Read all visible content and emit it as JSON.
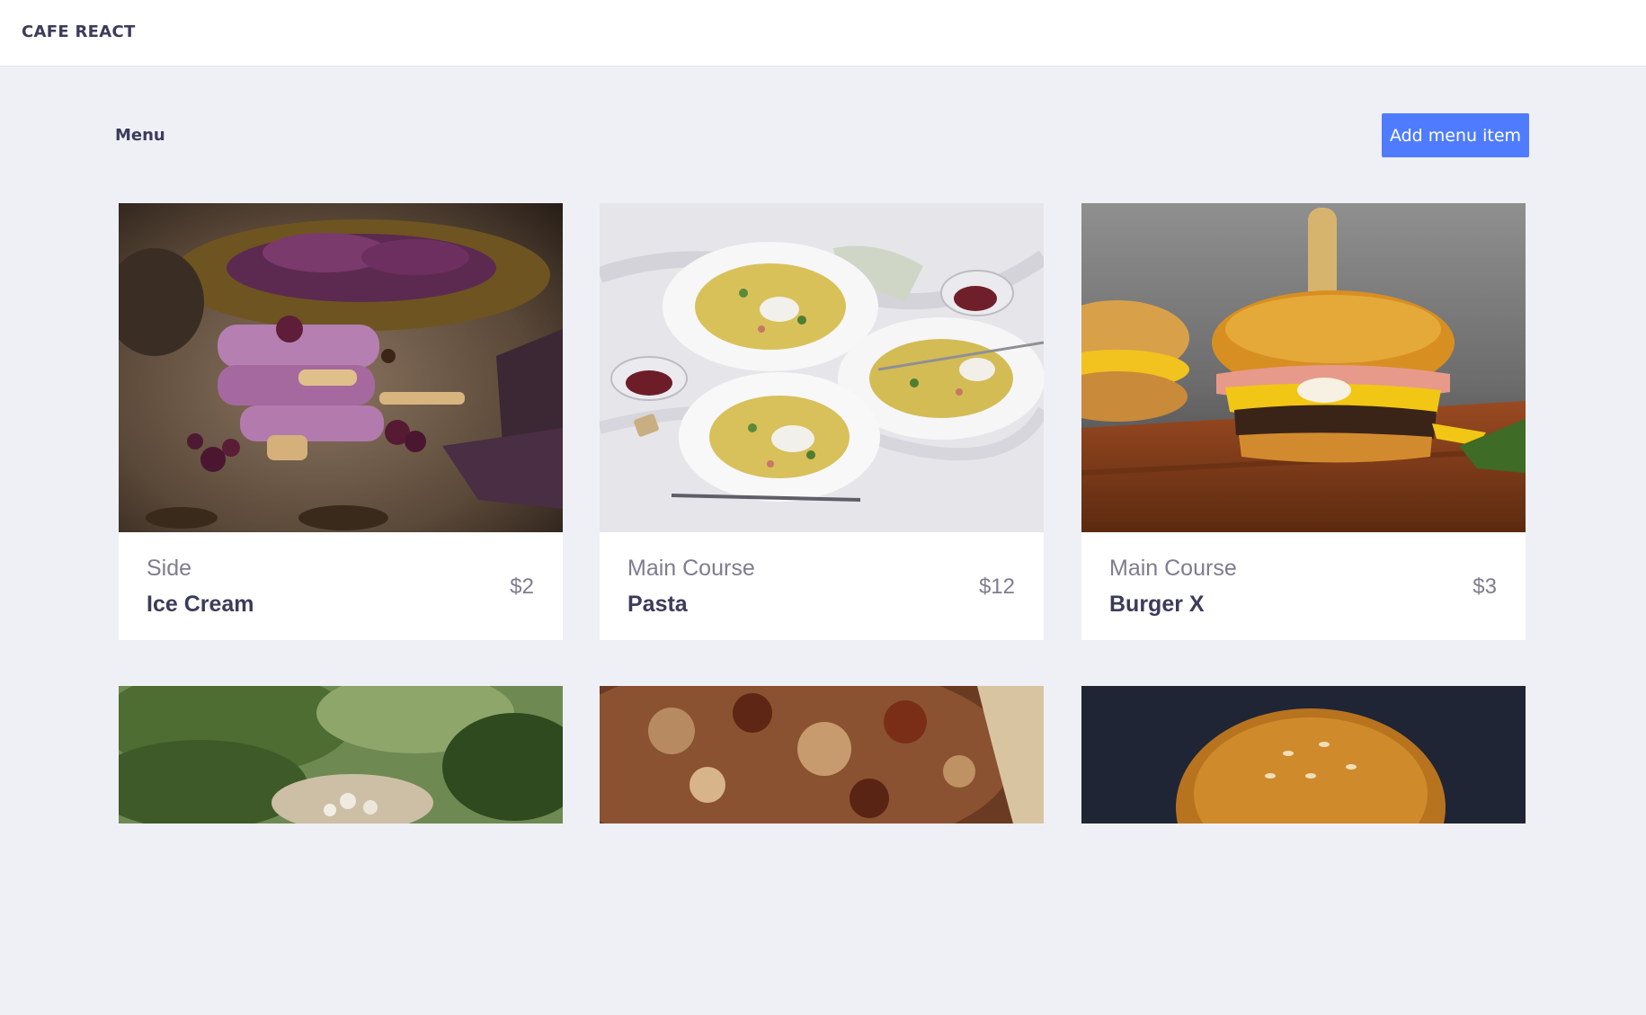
{
  "header": {
    "brand": "CAFE REACT"
  },
  "page": {
    "title": "Menu",
    "add_button_label": "Add menu item"
  },
  "menu_items": [
    {
      "category": "Side",
      "name": "Ice Cream",
      "price": "$2",
      "image": "ice-cream-photo"
    },
    {
      "category": "Main Course",
      "name": "Pasta",
      "price": "$12",
      "image": "pasta-photo"
    },
    {
      "category": "Main Course",
      "name": "Burger X",
      "price": "$3",
      "image": "burger-photo"
    },
    {
      "image": "salad-photo"
    },
    {
      "image": "pizza-photo"
    },
    {
      "image": "burger-bun-photo"
    }
  ],
  "colors": {
    "accent": "#4f7cff",
    "background": "#eff0f5",
    "text_dark": "#3b3b5a",
    "text_muted": "#7d7d8f"
  }
}
